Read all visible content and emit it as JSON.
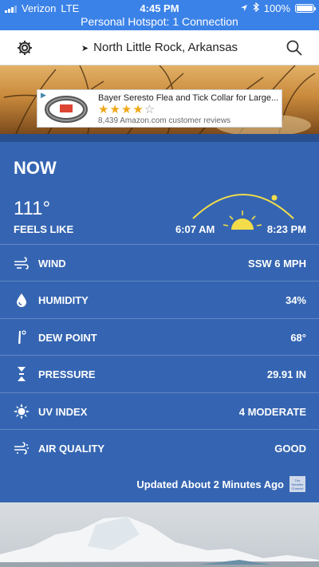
{
  "status_bar": {
    "carrier": "Verizon",
    "network": "LTE",
    "time": "4:45 PM",
    "battery": "100%",
    "battery_level": 1.0,
    "hotspot": "Personal Hotspot: 1 Connection"
  },
  "header": {
    "location": "North Little Rock, Arkansas"
  },
  "ad": {
    "title": "Bayer Seresto Flea and Tick Collar for Large...",
    "stars_filled": "★★★★",
    "stars_empty": "☆",
    "reviews": "8,439 Amazon.com customer reviews"
  },
  "now": {
    "heading": "NOW",
    "temperature": "111°",
    "feels_like_label": "FEELS LIKE",
    "sunrise": "6:07 AM",
    "sunset": "8:23 PM"
  },
  "conditions": [
    {
      "label": "WIND",
      "value": "SSW 6 MPH",
      "icon": "wind-icon"
    },
    {
      "label": "HUMIDITY",
      "value": "34%",
      "icon": "humidity-drop-icon"
    },
    {
      "label": "DEW POINT",
      "value": "68°",
      "icon": "thermometer-icon"
    },
    {
      "label": "PRESSURE",
      "value": "29.91 IN",
      "icon": "pressure-icon"
    },
    {
      "label": "UV INDEX",
      "value": "4 MODERATE",
      "icon": "sun-burst-icon"
    },
    {
      "label": "AIR QUALITY",
      "value": "GOOD",
      "icon": "air-quality-icon"
    }
  ],
  "footer": {
    "updated": "Updated About 2 Minutes Ago",
    "logo_text": "The Weather Channel"
  },
  "colors": {
    "status_bar": "#3b82e8",
    "card": "#3565b2",
    "accent_sun": "#f2dc4a"
  }
}
